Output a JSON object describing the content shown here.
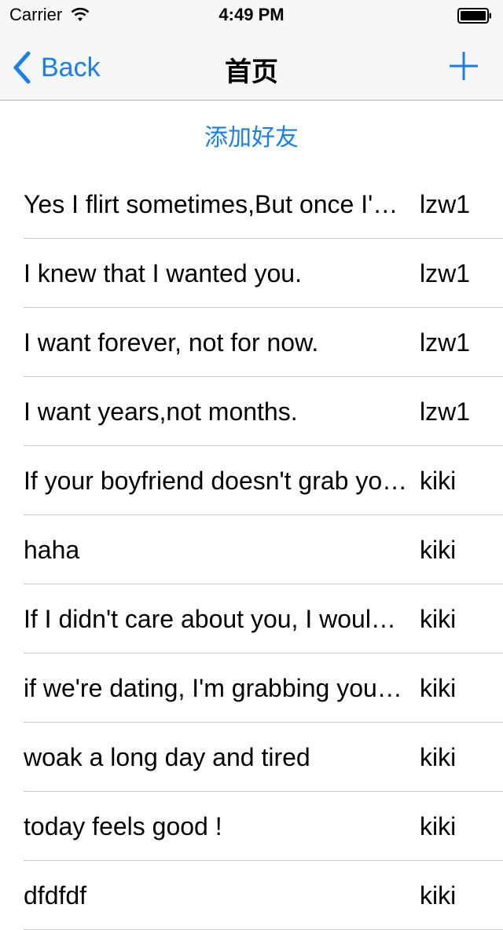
{
  "status_bar": {
    "carrier": "Carrier",
    "time": "4:49 PM"
  },
  "nav": {
    "back_label": "Back",
    "title": "首页",
    "add_icon": "plus-icon"
  },
  "add_friend_label": "添加好友",
  "colors": {
    "accent": "#157efb",
    "separator": "#c8c7cc"
  },
  "rows": [
    {
      "text": "Yes I flirt sometimes,But once I'm yours",
      "user": "lzw1"
    },
    {
      "text": "I knew that I wanted you.",
      "user": "lzw1"
    },
    {
      "text": "I want forever, not for now.",
      "user": "lzw1"
    },
    {
      "text": "I want years,not months.",
      "user": "lzw1"
    },
    {
      "text": "If your boyfriend doesn't grab your hand",
      "user": "kiki"
    },
    {
      "text": "haha",
      "user": "kiki"
    },
    {
      "text": "If I didn't care about you, I wouldn't",
      "user": "kiki"
    },
    {
      "text": "if we're dating, I'm grabbing your hand",
      "user": "kiki"
    },
    {
      "text": "woak a long day and tired",
      "user": "kiki"
    },
    {
      "text": "today feels good !",
      "user": "kiki"
    },
    {
      "text": "dfdfdf",
      "user": "kiki"
    }
  ]
}
